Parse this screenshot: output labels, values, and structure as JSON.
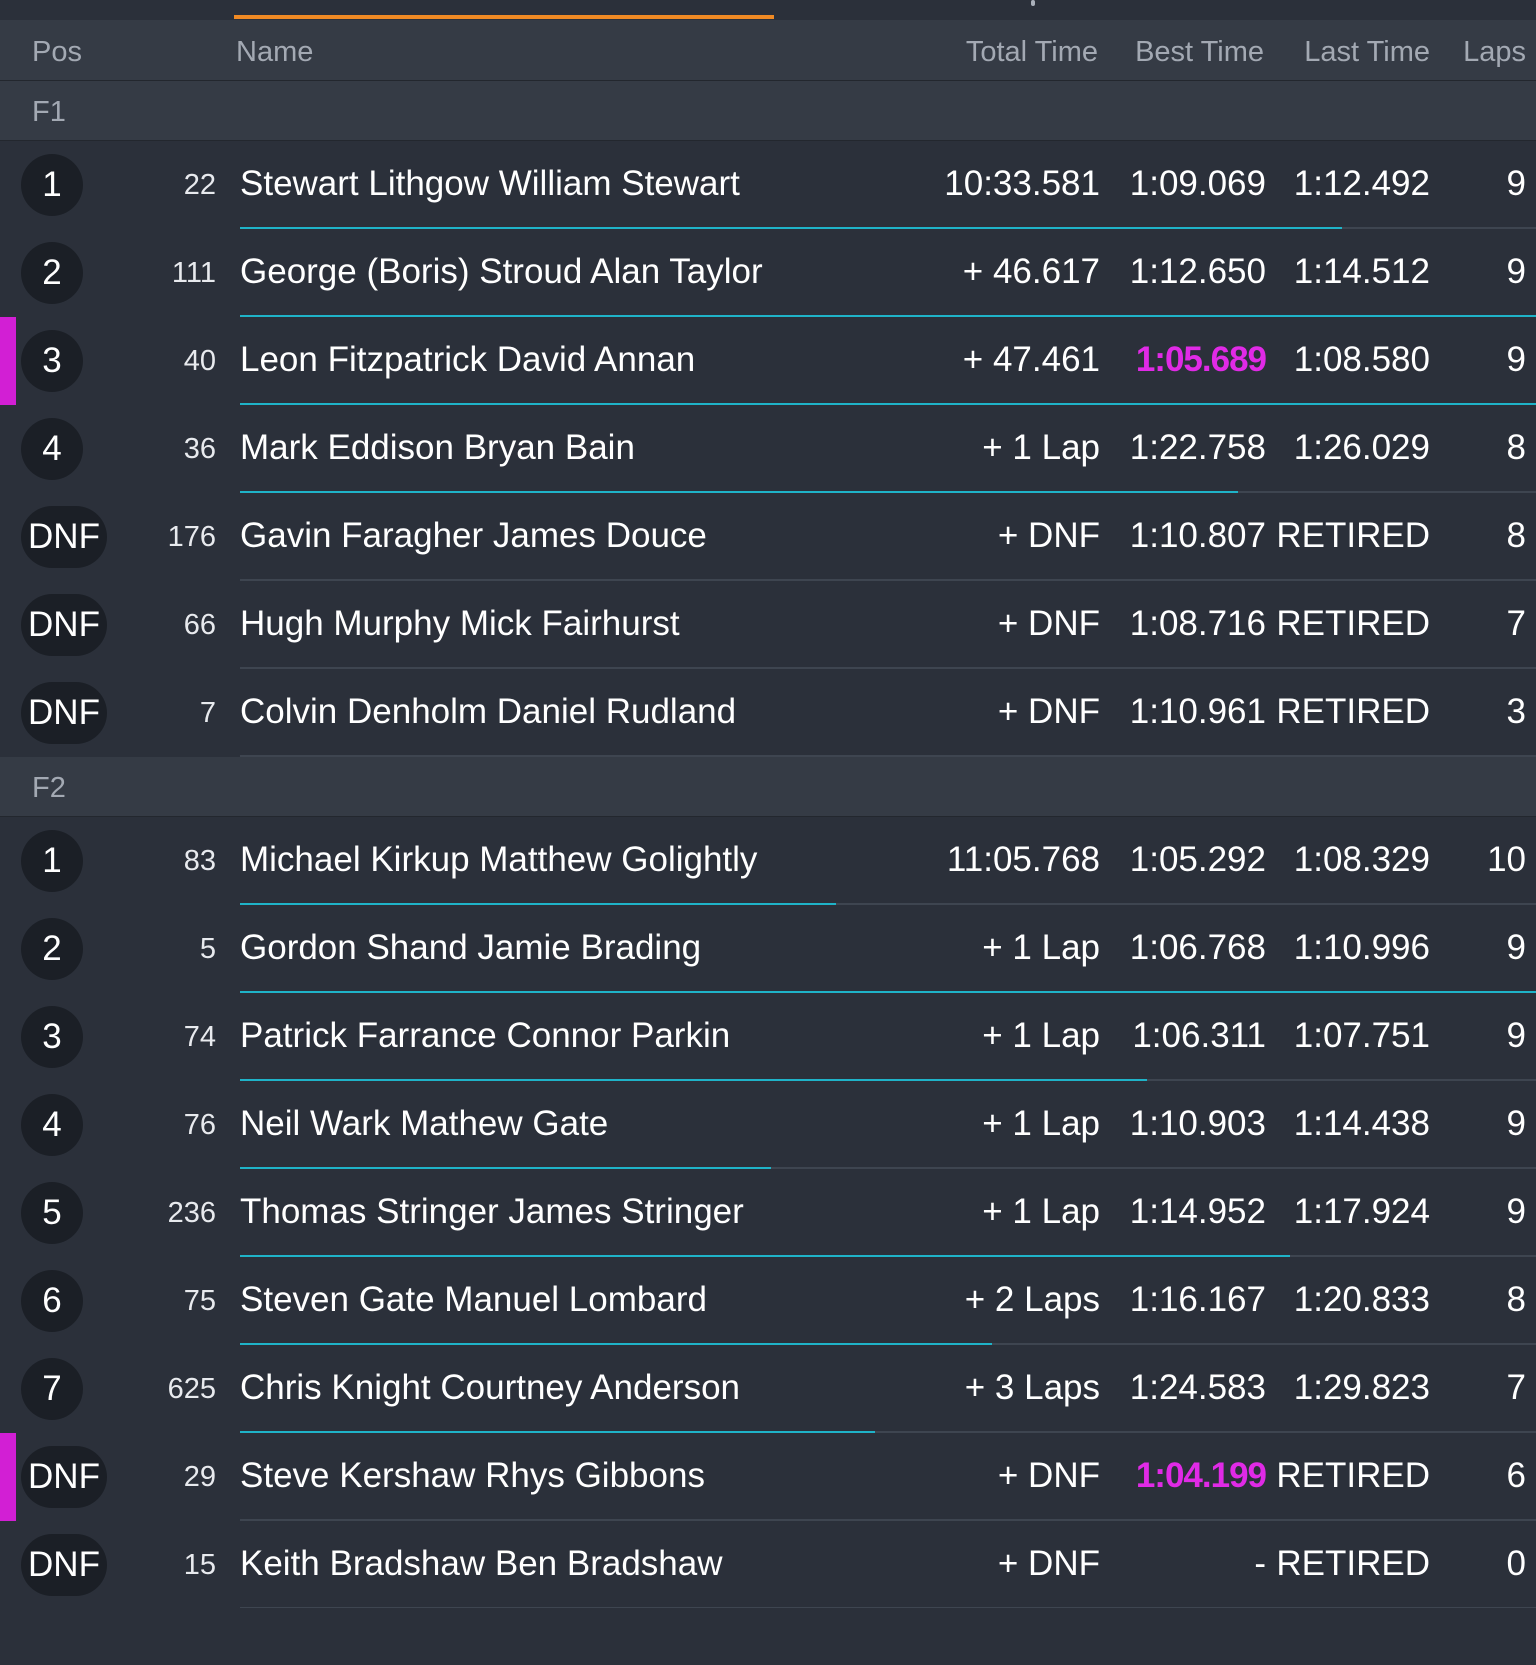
{
  "header": {
    "pos": "Pos",
    "name": "Name",
    "total_time": "Total Time",
    "best_time": "Best Time",
    "last_time": "Last Time",
    "laps": "Laps"
  },
  "colors": {
    "accent_tab": "#f08a24",
    "progress": "#1fb3c8",
    "fastest_lap": "#e02ae6",
    "background": "#2b303a"
  },
  "sections": [
    {
      "label": "F1",
      "rows": [
        {
          "pos": "1",
          "num": "22",
          "name": "Stewart Lithgow William Stewart",
          "total": "10:33.581",
          "best": "1:09.069",
          "last": "1:12.492",
          "laps": "9",
          "progress": 0.85,
          "highlight": false,
          "fastest": false
        },
        {
          "pos": "2",
          "num": "111",
          "name": "George (Boris) Stroud Alan Taylor",
          "total": "+ 46.617",
          "best": "1:12.650",
          "last": "1:14.512",
          "laps": "9",
          "progress": 1.0,
          "highlight": false,
          "fastest": false
        },
        {
          "pos": "3",
          "num": "40",
          "name": "Leon Fitzpatrick David Annan",
          "total": "+ 47.461",
          "best": "1:05.689",
          "last": "1:08.580",
          "laps": "9",
          "progress": 1.0,
          "highlight": true,
          "fastest": true
        },
        {
          "pos": "4",
          "num": "36",
          "name": "Mark Eddison Bryan Bain",
          "total": "+ 1 Lap",
          "best": "1:22.758",
          "last": "1:26.029",
          "laps": "8",
          "progress": 0.77,
          "highlight": false,
          "fastest": false
        },
        {
          "pos": "DNF",
          "num": "176",
          "name": "Gavin Faragher James Douce",
          "total": "+ DNF",
          "best": "1:10.807",
          "last": "RETIRED",
          "laps": "8",
          "progress": 0,
          "highlight": false,
          "fastest": false
        },
        {
          "pos": "DNF",
          "num": "66",
          "name": "Hugh Murphy Mick Fairhurst",
          "total": "+ DNF",
          "best": "1:08.716",
          "last": "RETIRED",
          "laps": "7",
          "progress": 0,
          "highlight": false,
          "fastest": false
        },
        {
          "pos": "DNF",
          "num": "7",
          "name": "Colvin Denholm Daniel Rudland",
          "total": "+ DNF",
          "best": "1:10.961",
          "last": "RETIRED",
          "laps": "3",
          "progress": 0,
          "highlight": false,
          "fastest": false
        }
      ]
    },
    {
      "label": "F2",
      "rows": [
        {
          "pos": "1",
          "num": "83",
          "name": "Michael Kirkup Matthew Golightly",
          "total": "11:05.768",
          "best": "1:05.292",
          "last": "1:08.329",
          "laps": "10",
          "progress": 0.46,
          "highlight": false,
          "fastest": false
        },
        {
          "pos": "2",
          "num": "5",
          "name": "Gordon Shand Jamie Brading",
          "total": "+ 1 Lap",
          "best": "1:06.768",
          "last": "1:10.996",
          "laps": "9",
          "progress": 1.0,
          "highlight": false,
          "fastest": false
        },
        {
          "pos": "3",
          "num": "74",
          "name": "Patrick Farrance Connor Parkin",
          "total": "+ 1 Lap",
          "best": "1:06.311",
          "last": "1:07.751",
          "laps": "9",
          "progress": 0.7,
          "highlight": false,
          "fastest": false
        },
        {
          "pos": "4",
          "num": "76",
          "name": "Neil Wark Mathew Gate",
          "total": "+ 1 Lap",
          "best": "1:10.903",
          "last": "1:14.438",
          "laps": "9",
          "progress": 0.41,
          "highlight": false,
          "fastest": false
        },
        {
          "pos": "5",
          "num": "236",
          "name": "Thomas Stringer James Stringer",
          "total": "+ 1 Lap",
          "best": "1:14.952",
          "last": "1:17.924",
          "laps": "9",
          "progress": 0.81,
          "highlight": false,
          "fastest": false
        },
        {
          "pos": "6",
          "num": "75",
          "name": "Steven Gate Manuel Lombard",
          "total": "+ 2 Laps",
          "best": "1:16.167",
          "last": "1:20.833",
          "laps": "8",
          "progress": 0.58,
          "highlight": false,
          "fastest": false
        },
        {
          "pos": "7",
          "num": "625",
          "name": "Chris Knight Courtney Anderson",
          "total": "+ 3 Laps",
          "best": "1:24.583",
          "last": "1:29.823",
          "laps": "7",
          "progress": 0.49,
          "highlight": false,
          "fastest": false
        },
        {
          "pos": "DNF",
          "num": "29",
          "name": "Steve Kershaw Rhys Gibbons",
          "total": "+ DNF",
          "best": "1:04.199",
          "last": "RETIRED",
          "laps": "6",
          "progress": 0,
          "highlight": true,
          "fastest": true
        },
        {
          "pos": "DNF",
          "num": "15",
          "name": "Keith Bradshaw Ben Bradshaw",
          "total": "+ DNF",
          "best": "-",
          "last": "RETIRED",
          "laps": "0",
          "progress": 0,
          "highlight": false,
          "fastest": false
        }
      ]
    }
  ]
}
